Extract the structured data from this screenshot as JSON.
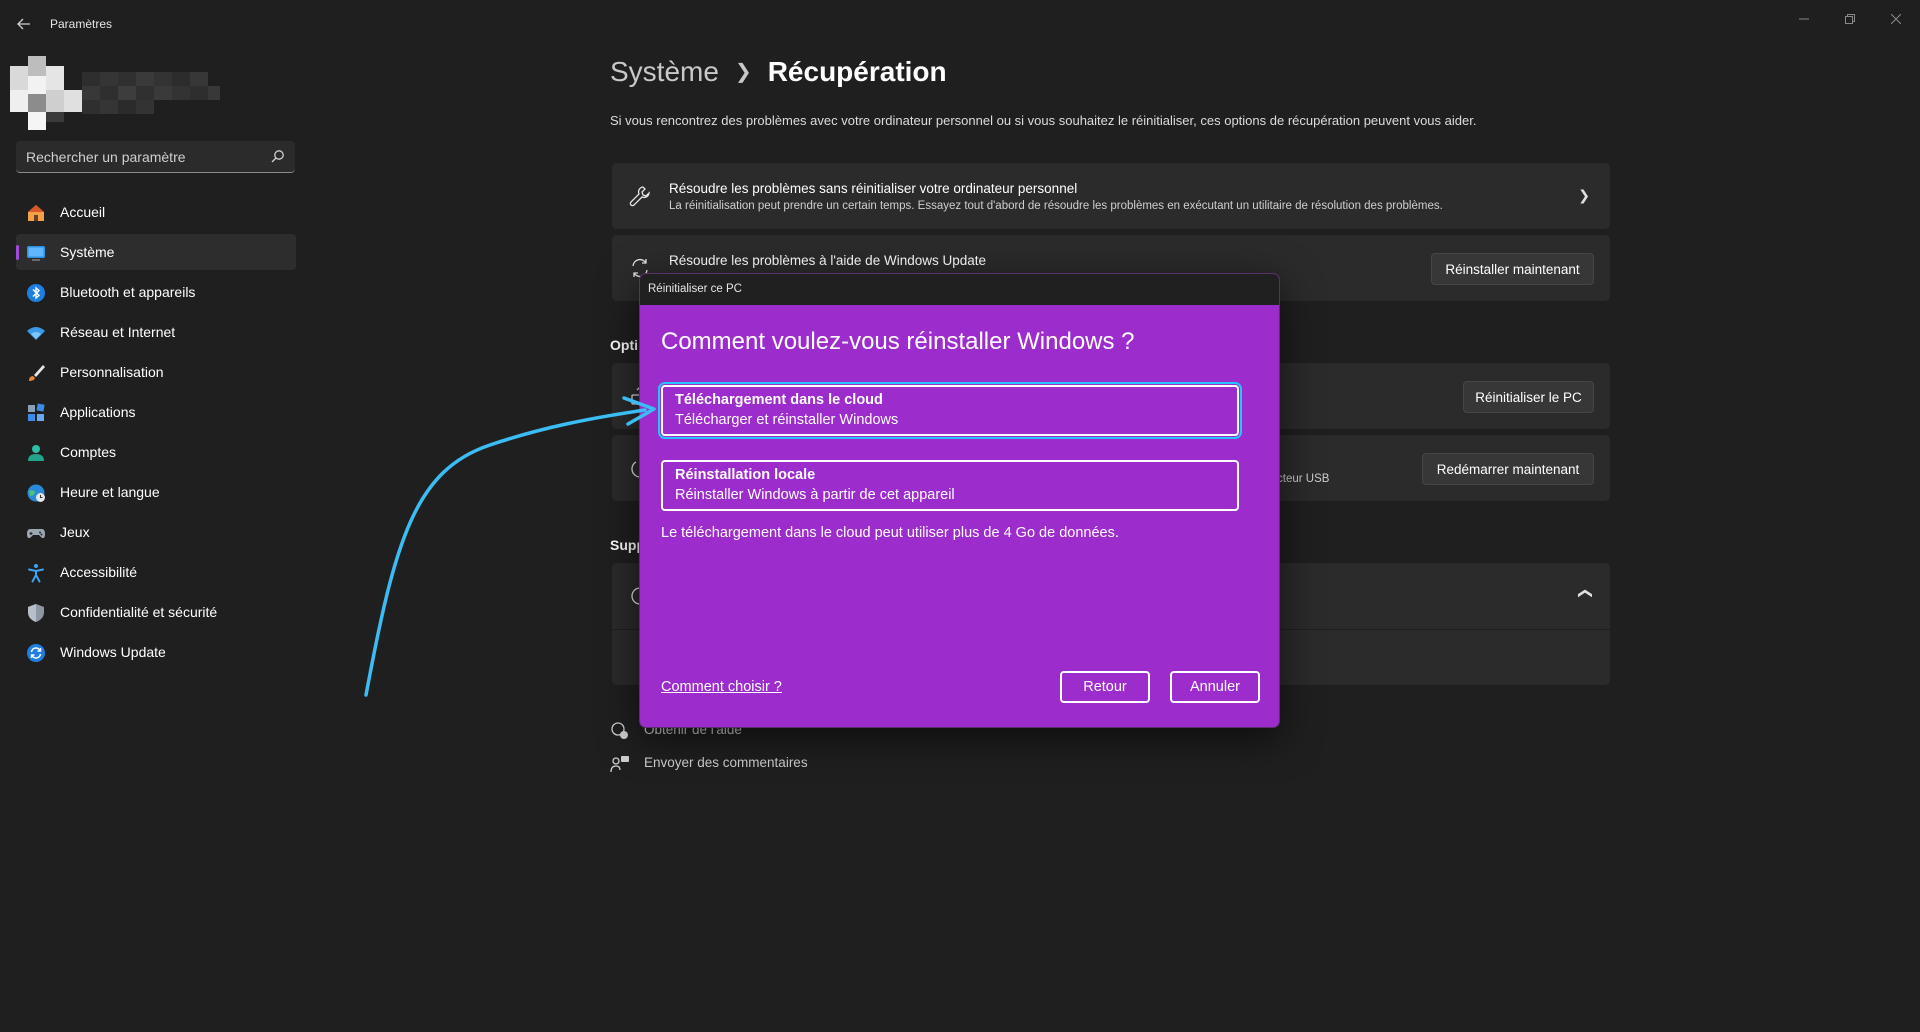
{
  "app": {
    "title": "Paramètres",
    "back_icon": "back-arrow-icon"
  },
  "sidebar": {
    "search_placeholder": "Rechercher un paramètre",
    "items": [
      {
        "label": "Accueil",
        "icon": "home-icon"
      },
      {
        "label": "Système",
        "icon": "monitor-icon",
        "active": true
      },
      {
        "label": "Bluetooth et appareils",
        "icon": "bluetooth-icon"
      },
      {
        "label": "Réseau et Internet",
        "icon": "wifi-icon"
      },
      {
        "label": "Personnalisation",
        "icon": "brush-icon"
      },
      {
        "label": "Applications",
        "icon": "apps-icon"
      },
      {
        "label": "Comptes",
        "icon": "person-icon"
      },
      {
        "label": "Heure et langue",
        "icon": "globe-clock-icon"
      },
      {
        "label": "Jeux",
        "icon": "gamepad-icon"
      },
      {
        "label": "Accessibilité",
        "icon": "accessibility-icon"
      },
      {
        "label": "Confidentialité et sécurité",
        "icon": "shield-icon"
      },
      {
        "label": "Windows Update",
        "icon": "update-icon"
      }
    ]
  },
  "main": {
    "breadcrumb_parent": "Système",
    "breadcrumb_current": "Récupération",
    "description": "Si vous rencontrez des problèmes avec votre ordinateur personnel ou si vous souhaitez le réinitialiser, ces options de récupération peuvent vous aider.",
    "card_troubleshoot": {
      "title": "Résoudre les problèmes sans réinitialiser votre ordinateur personnel",
      "subtitle": "La réinitialisation peut prendre un certain temps. Essayez tout d'abord de résoudre les problèmes en exécutant un utilitaire de résolution des problèmes."
    },
    "card_update": {
      "title": "Résoudre les problèmes à l'aide de Windows Update",
      "button": "Réinstaller maintenant"
    },
    "section_options": "Opti",
    "card_reset": {
      "button": "Réinitialiser le PC"
    },
    "card_advanced": {
      "subtitle_fragment": "cteur USB",
      "button": "Redémarrer maintenant"
    },
    "section_support": "Supp",
    "footer": {
      "help": "Obtenir de l'aide",
      "feedback": "Envoyer des commentaires"
    }
  },
  "dialog": {
    "window_title": "Réinitialiser ce PC",
    "heading": "Comment voulez-vous réinstaller Windows ?",
    "options": [
      {
        "title": "Téléchargement dans le cloud",
        "subtitle": "Télécharger et réinstaller Windows",
        "selected": true
      },
      {
        "title": "Réinstallation locale",
        "subtitle": "Réinstaller Windows à partir de cet appareil",
        "selected": false
      }
    ],
    "note": "Le téléchargement dans le cloud peut utiliser plus de 4 Go de données.",
    "help_link": "Comment choisir ?",
    "back_button": "Retour",
    "cancel_button": "Annuler",
    "background_color": "#9d2ccc"
  },
  "colors": {
    "accent": "#9d4cd8",
    "annotation_arrow": "#3bbcf2",
    "background": "#1f1f1f",
    "card": "#2b2b2b"
  }
}
